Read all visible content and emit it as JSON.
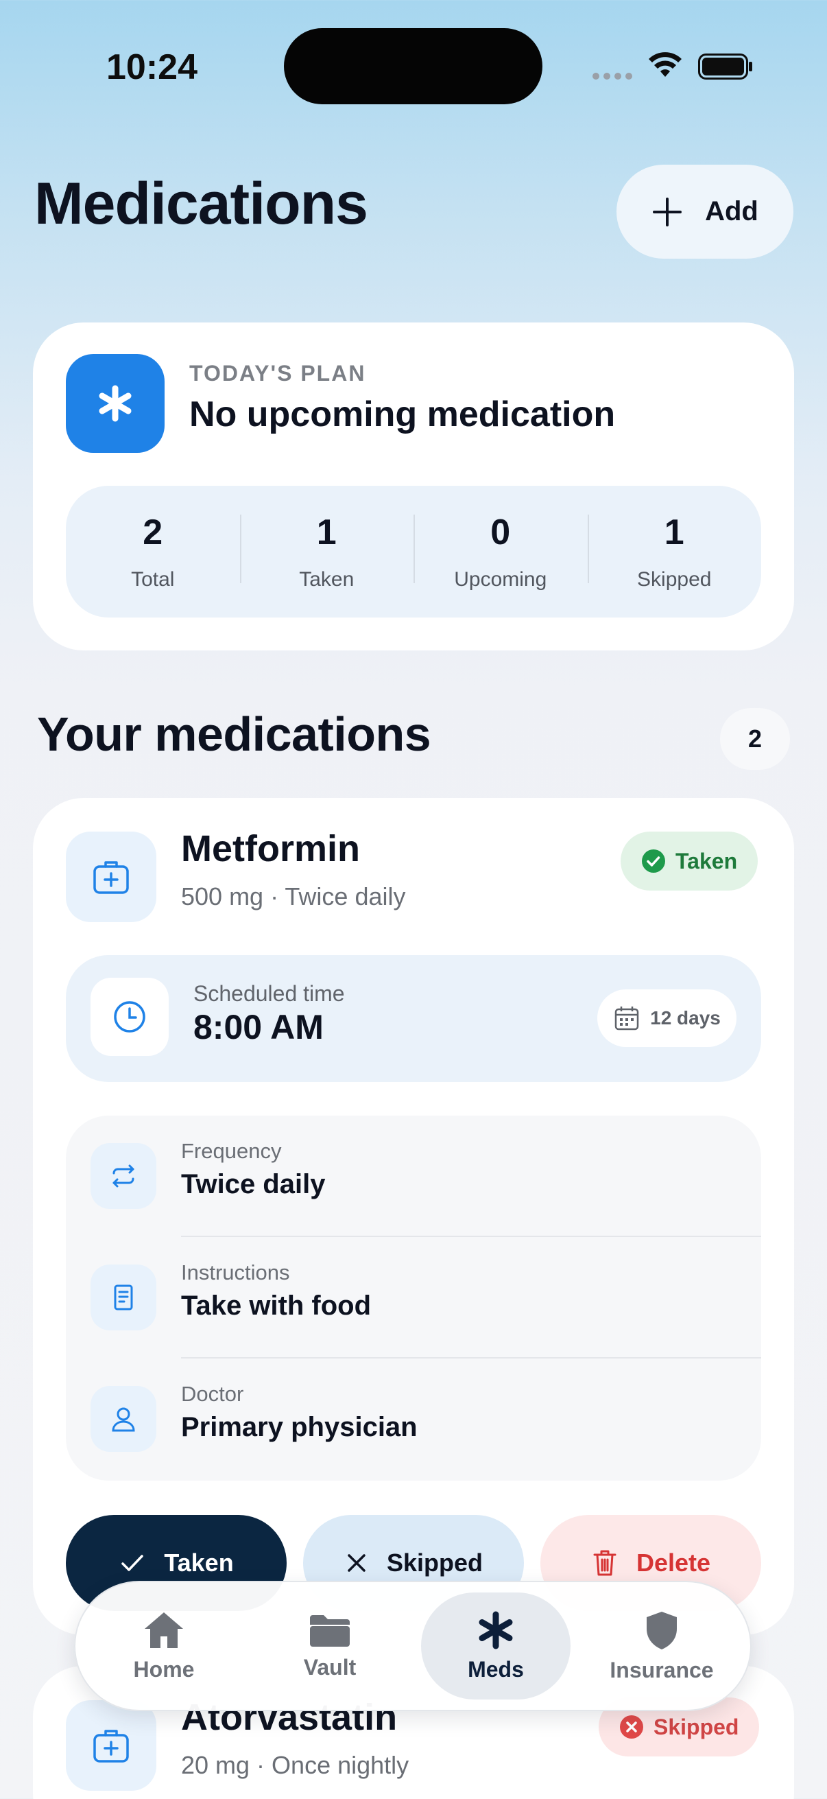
{
  "status_bar": {
    "time": "10:24"
  },
  "header": {
    "title": "Medications",
    "add_label": "Add"
  },
  "plan": {
    "kicker": "TODAY'S PLAN",
    "title": "No upcoming medication",
    "stats": [
      {
        "value": "2",
        "label": "Total"
      },
      {
        "value": "1",
        "label": "Taken"
      },
      {
        "value": "0",
        "label": "Upcoming"
      },
      {
        "value": "1",
        "label": "Skipped"
      }
    ]
  },
  "section": {
    "title": "Your medications",
    "count": "2"
  },
  "medications": [
    {
      "name": "Metformin",
      "dose": "500 mg · Twice daily",
      "status": "Taken",
      "schedule_caption": "Scheduled time",
      "schedule_time": "8:00 AM",
      "duration": "12 days",
      "details": [
        {
          "caption": "Frequency",
          "value": "Twice daily"
        },
        {
          "caption": "Instructions",
          "value": "Take with food"
        },
        {
          "caption": "Doctor",
          "value": "Primary physician"
        }
      ],
      "actions": {
        "taken": "Taken",
        "skipped": "Skipped",
        "delete": "Delete"
      }
    },
    {
      "name": "Atorvastatin",
      "dose": "20 mg · Once nightly",
      "status": "Skipped"
    }
  ],
  "tabbar": [
    {
      "label": "Home",
      "icon": "home-icon"
    },
    {
      "label": "Vault",
      "icon": "folder-icon"
    },
    {
      "label": "Meds",
      "icon": "asterisk-icon",
      "active": true
    },
    {
      "label": "Insurance",
      "icon": "shield-icon"
    }
  ],
  "colors": {
    "accent": "#1f82e7",
    "navy": "#0b2641",
    "taken_green": "#1e7a3b",
    "skipped_red": "#d04545"
  }
}
